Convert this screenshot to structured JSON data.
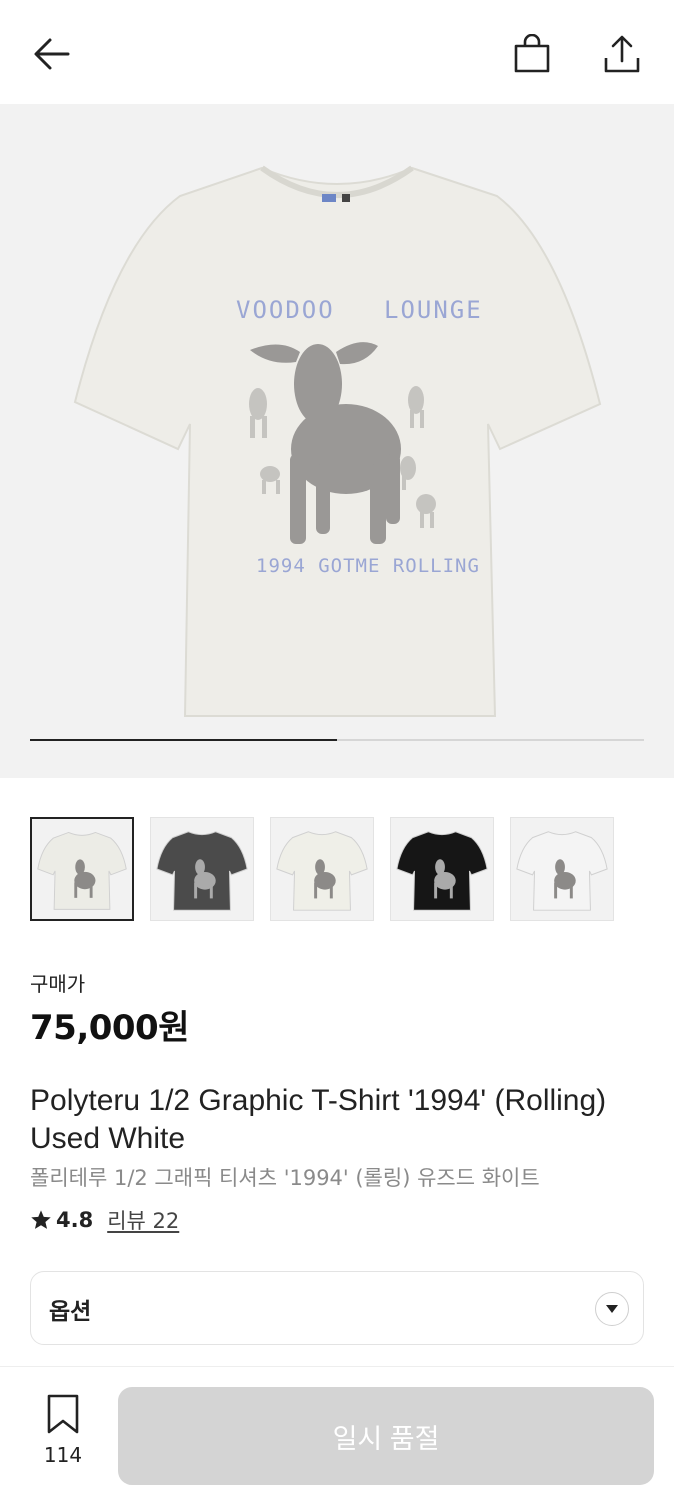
{
  "header": {
    "back_icon": "back-arrow-icon",
    "bag_icon": "shopping-bag-icon",
    "share_icon": "share-icon"
  },
  "gallery": {
    "image_count": 2,
    "current_index": 1,
    "progress_fraction": 0.5,
    "print_text_top_left": "VOODOO",
    "print_text_top_right": "LOUNGE",
    "print_text_bottom": "1994 GOTME ROLLING",
    "thumbnails": [
      {
        "name": "thumb-used-white",
        "color": "#ecece6",
        "selected": true
      },
      {
        "name": "thumb-charcoal",
        "color": "#4b4b4b",
        "selected": false
      },
      {
        "name": "thumb-ivory",
        "color": "#efefe8",
        "selected": false
      },
      {
        "name": "thumb-black",
        "color": "#161616",
        "selected": false
      },
      {
        "name": "thumb-white",
        "color": "#f4f4f4",
        "selected": false
      }
    ]
  },
  "product": {
    "price_label": "구매가",
    "price": "75,000원",
    "title_en": "Polyteru 1/2 Graphic T-Shirt '1994' (Rolling) Used White",
    "title_ko": "폴리테루 1/2 그래픽 티셔츠 '1994' (롤링) 유즈드 화이트",
    "rating": "4.8",
    "review_link": "리뷰 22"
  },
  "options": {
    "label": "옵션",
    "caret_icon": "chevron-down-icon"
  },
  "bottom_bar": {
    "wishlist_icon": "bookmark-icon",
    "wishlist_count": "114",
    "buy_button_label": "일시 품절"
  },
  "colors": {
    "accent_dark": "#222222",
    "disabled_button": "#d4d4d4",
    "print_blue": "#9aa6d4"
  }
}
